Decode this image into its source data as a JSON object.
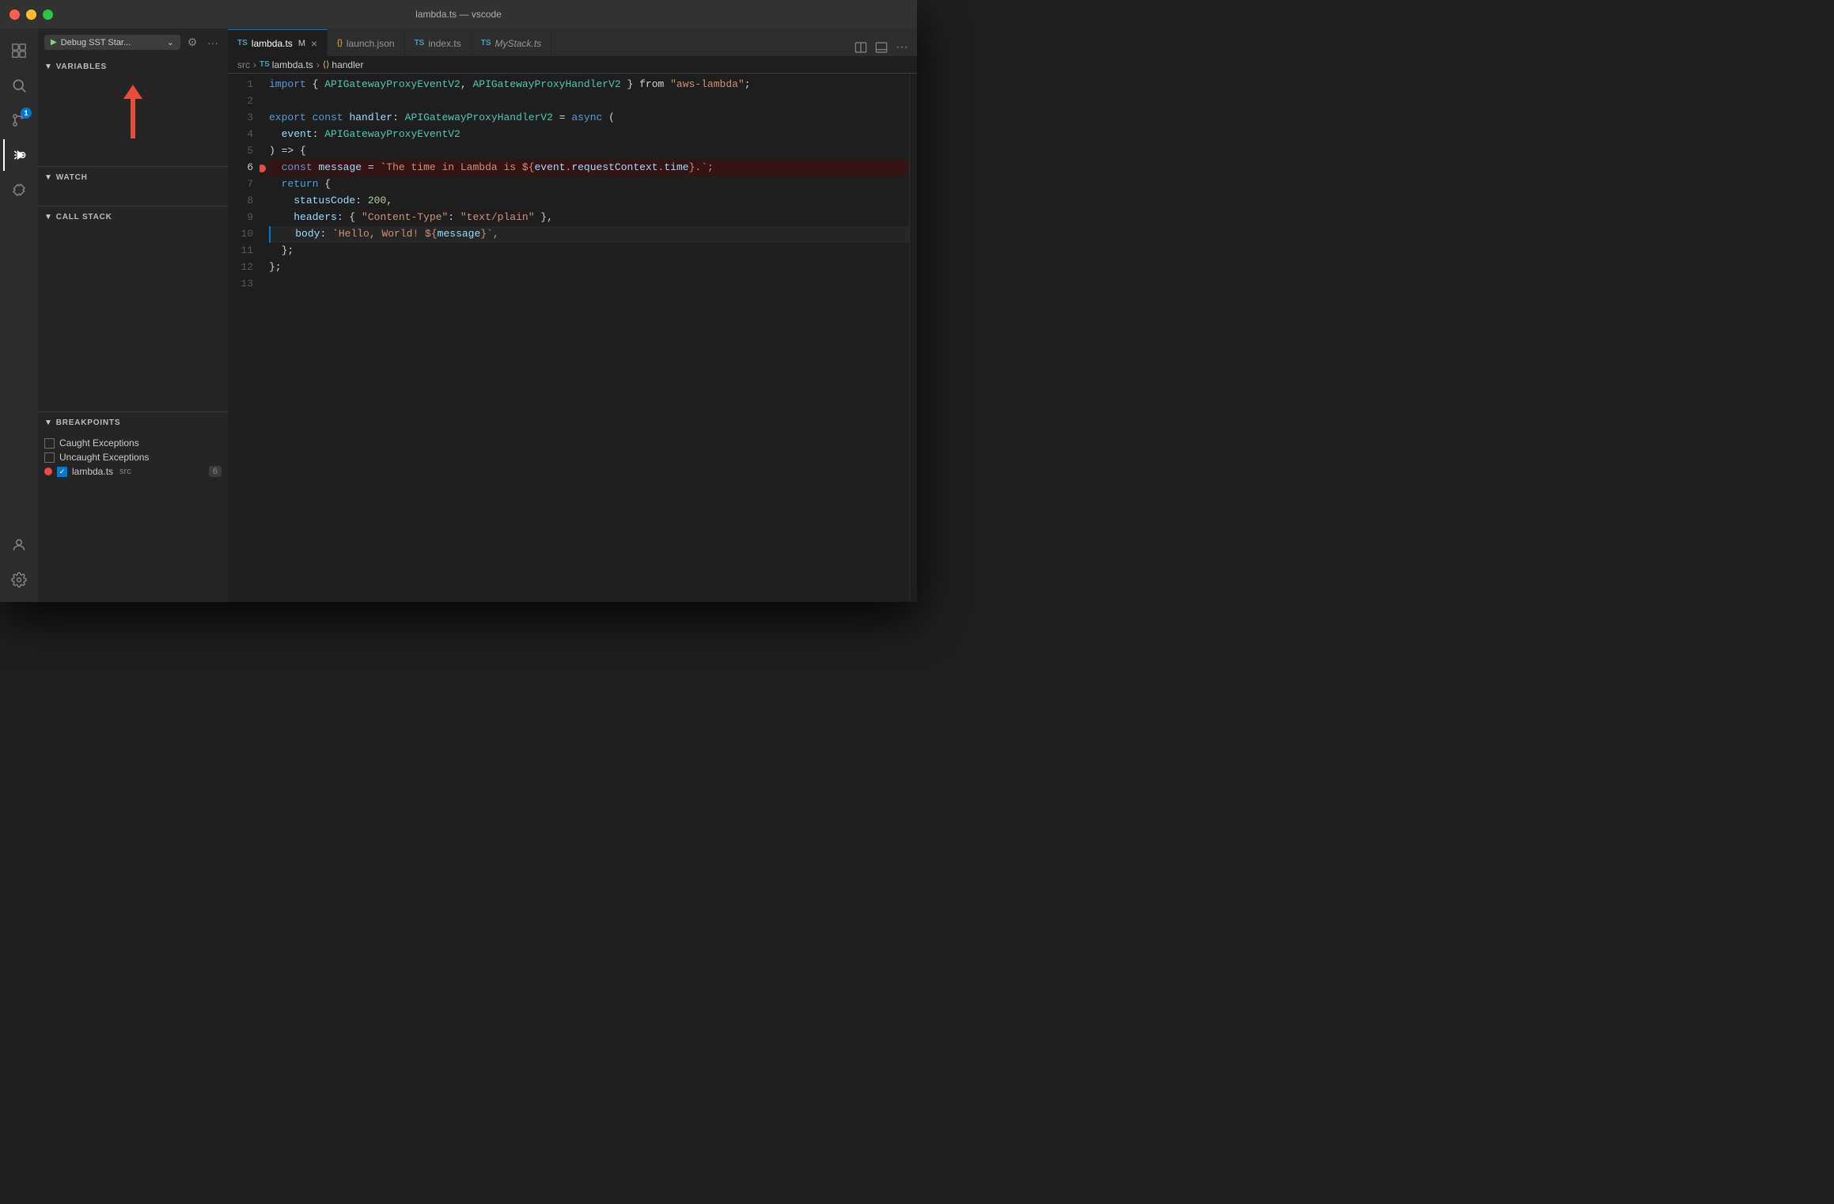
{
  "titlebar": {
    "title": "lambda.ts — vscode"
  },
  "activity_bar": {
    "icons": [
      {
        "name": "explorer-icon",
        "symbol": "⎘",
        "active": false
      },
      {
        "name": "search-icon",
        "symbol": "🔍",
        "active": false
      },
      {
        "name": "source-control-icon",
        "symbol": "⑂",
        "active": false,
        "badge": "1"
      },
      {
        "name": "debug-icon",
        "symbol": "▷",
        "active": true
      },
      {
        "name": "extensions-icon",
        "symbol": "⊞",
        "active": false
      }
    ],
    "bottom_icons": [
      {
        "name": "account-icon",
        "symbol": "◎"
      },
      {
        "name": "settings-icon",
        "symbol": "⚙"
      }
    ]
  },
  "sidebar": {
    "toolbar": {
      "debug_config": "Debug SST Star...",
      "play_symbol": "▶"
    },
    "variables": {
      "header": "VARIABLES",
      "expanded": true
    },
    "watch": {
      "header": "WATCH",
      "expanded": true
    },
    "call_stack": {
      "header": "CALL STACK",
      "expanded": true
    },
    "breakpoints": {
      "header": "BREAKPOINTS",
      "expanded": true,
      "items": [
        {
          "label": "Caught Exceptions",
          "checked": false,
          "has_dot": false
        },
        {
          "label": "Uncaught Exceptions",
          "checked": false,
          "has_dot": false
        },
        {
          "label": "lambda.ts",
          "src": "src",
          "line": "6",
          "checked": true,
          "has_dot": true
        }
      ]
    }
  },
  "editor": {
    "tabs": [
      {
        "label": "lambda.ts",
        "type": "ts",
        "active": true,
        "modified": true
      },
      {
        "label": "launch.json",
        "type": "json",
        "active": false,
        "modified": false
      },
      {
        "label": "index.ts",
        "type": "ts",
        "active": false,
        "modified": false
      },
      {
        "label": "MyStack.ts",
        "type": "ts",
        "active": false,
        "modified": false,
        "italic": true
      }
    ],
    "breadcrumb": {
      "parts": [
        "src",
        "lambda.ts",
        "handler"
      ]
    },
    "lines": [
      {
        "num": 1,
        "tokens": [
          {
            "text": "import",
            "cls": "kw"
          },
          {
            "text": " { ",
            "cls": "op"
          },
          {
            "text": "APIGatewayProxyEventV2",
            "cls": "type"
          },
          {
            "text": ", ",
            "cls": "op"
          },
          {
            "text": "APIGatewayProxyHandlerV2",
            "cls": "type"
          },
          {
            "text": " } from ",
            "cls": "op"
          },
          {
            "text": "\"aws-lambda\"",
            "cls": "str"
          },
          {
            "text": ";",
            "cls": "op"
          }
        ]
      },
      {
        "num": 2,
        "tokens": []
      },
      {
        "num": 3,
        "tokens": [
          {
            "text": "export",
            "cls": "kw"
          },
          {
            "text": " ",
            "cls": "op"
          },
          {
            "text": "const",
            "cls": "kw"
          },
          {
            "text": " ",
            "cls": "op"
          },
          {
            "text": "handler",
            "cls": "var"
          },
          {
            "text": ": ",
            "cls": "op"
          },
          {
            "text": "APIGatewayProxyHandlerV2",
            "cls": "type"
          },
          {
            "text": " = ",
            "cls": "op"
          },
          {
            "text": "async",
            "cls": "kw"
          },
          {
            "text": " (",
            "cls": "op"
          }
        ]
      },
      {
        "num": 4,
        "tokens": [
          {
            "text": "  event",
            "cls": "var"
          },
          {
            "text": ": ",
            "cls": "op"
          },
          {
            "text": "APIGatewayProxyEventV2",
            "cls": "type"
          }
        ]
      },
      {
        "num": 5,
        "tokens": [
          {
            "text": ") => {",
            "cls": "op"
          }
        ]
      },
      {
        "num": 6,
        "tokens": [
          {
            "text": "  const",
            "cls": "kw"
          },
          {
            "text": " ",
            "cls": "op"
          },
          {
            "text": "message",
            "cls": "var"
          },
          {
            "text": " = `",
            "cls": "op"
          },
          {
            "text": "The time in Lambda is ${",
            "cls": "str"
          },
          {
            "text": "event",
            "cls": "var"
          },
          {
            "text": ".",
            "cls": "str"
          },
          {
            "text": "requestContext",
            "cls": "prop"
          },
          {
            "text": ".",
            "cls": "str"
          },
          {
            "text": "time",
            "cls": "prop"
          },
          {
            "text": "}",
            "cls": "str"
          },
          {
            "text": ".`;",
            "cls": "str"
          }
        ],
        "breakpoint": true
      },
      {
        "num": 7,
        "tokens": [
          {
            "text": "  return",
            "cls": "kw"
          },
          {
            "text": " {",
            "cls": "op"
          }
        ]
      },
      {
        "num": 8,
        "tokens": [
          {
            "text": "    statusCode",
            "cls": "prop"
          },
          {
            "text": ": ",
            "cls": "op"
          },
          {
            "text": "200",
            "cls": "num"
          },
          {
            "text": ",",
            "cls": "op"
          }
        ]
      },
      {
        "num": 9,
        "tokens": [
          {
            "text": "    headers",
            "cls": "prop"
          },
          {
            "text": ": { ",
            "cls": "op"
          },
          {
            "text": "\"Content-Type\"",
            "cls": "str"
          },
          {
            "text": ": ",
            "cls": "op"
          },
          {
            "text": "\"text/plain\"",
            "cls": "str"
          },
          {
            "text": " },",
            "cls": "op"
          }
        ]
      },
      {
        "num": 10,
        "tokens": [
          {
            "text": "    body",
            "cls": "prop"
          },
          {
            "text": ": `",
            "cls": "op"
          },
          {
            "text": "Hello, World! ${",
            "cls": "str"
          },
          {
            "text": "message",
            "cls": "var"
          },
          {
            "text": "}`, ",
            "cls": "str"
          }
        ],
        "current": true
      },
      {
        "num": 11,
        "tokens": [
          {
            "text": "  };",
            "cls": "op"
          }
        ]
      },
      {
        "num": 12,
        "tokens": [
          {
            "text": "};",
            "cls": "op"
          }
        ]
      },
      {
        "num": 13,
        "tokens": []
      }
    ]
  }
}
